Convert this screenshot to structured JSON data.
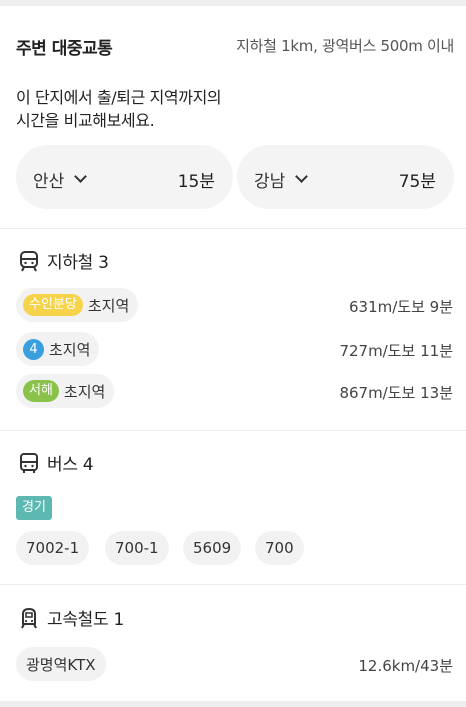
{
  "transit": {
    "title": "주변 대중교통",
    "subtitle": "지하철 1km, 광역버스 500m 이내",
    "description_line1": "이 단지에서 출/퇴근 지역까지의",
    "description_line2": "시간을 비교해보세요.",
    "destinations": [
      {
        "name": "안산",
        "time": "15분"
      },
      {
        "name": "강남",
        "time": "75분"
      }
    ]
  },
  "subway": {
    "title": "지하철 3",
    "icon": "subway-icon",
    "stations": [
      {
        "line": "수인분당",
        "line_color": "#f5d44c",
        "line_text_color": "#ffffff",
        "station": "초지역",
        "distance": "631m/도보 9분"
      },
      {
        "line": "4",
        "line_color": "#3a9fde",
        "line_text_color": "#ffffff",
        "station": "초지역",
        "distance": "727m/도보 11분"
      },
      {
        "line": "서해",
        "line_color": "#8bc34a",
        "line_text_color": "#ffffff",
        "station": "초지역",
        "distance": "867m/도보 13분"
      }
    ]
  },
  "bus": {
    "title": "버스 4",
    "icon": "bus-icon",
    "region_tag": "경기",
    "region_color": "#5cb8b1",
    "routes": [
      "7002-1",
      "700-1",
      "5609",
      "700"
    ]
  },
  "rail": {
    "title": "고속철도 1",
    "icon": "train-icon",
    "stations": [
      {
        "station": "광명역KTX",
        "distance": "12.6km/43분"
      }
    ]
  }
}
